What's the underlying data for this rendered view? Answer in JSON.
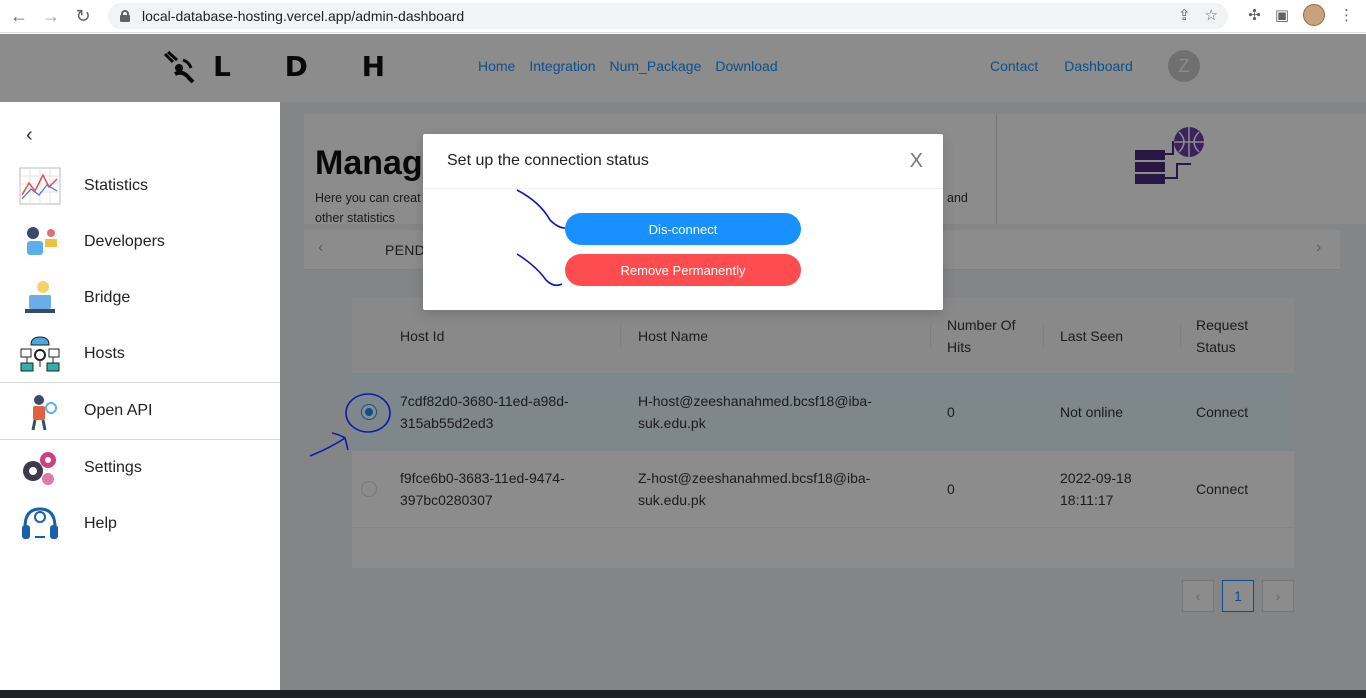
{
  "browser": {
    "url": "local-database-hosting.vercel.app/admin-dashboard"
  },
  "nav": {
    "logo_text": "L D H",
    "links": [
      "Home",
      "Integration",
      "Num_Package",
      "Download"
    ],
    "links_right": [
      "Contact",
      "Dashboard"
    ],
    "avatar_initial": "Z"
  },
  "sidebar": {
    "items": [
      {
        "label": "Statistics",
        "icon": "statistics-icon"
      },
      {
        "label": "Developers",
        "icon": "developers-icon"
      },
      {
        "label": "Bridge",
        "icon": "bridge-icon"
      },
      {
        "label": "Hosts",
        "icon": "hosts-icon"
      },
      {
        "label": "Open API",
        "icon": "open-api-icon"
      },
      {
        "label": "Settings",
        "icon": "settings-icon"
      },
      {
        "label": "Help",
        "icon": "help-icon"
      }
    ]
  },
  "hero": {
    "title": "Manage",
    "description_line1_start": "Here you can creat",
    "description_line1_end": "and",
    "description_line2": "other statistics"
  },
  "tabs": {
    "active": "PEND"
  },
  "table": {
    "headers": {
      "host_id": "Host Id",
      "host_name": "Host Name",
      "hits_line1": "Number Of",
      "hits_line2": "Hits",
      "last_seen": "Last Seen",
      "status_line1": "Request",
      "status_line2": "Status"
    },
    "rows": [
      {
        "host_id_1": "7cdf82d0-3680-11ed-a98d-",
        "host_id_2": "315ab55d2ed3",
        "host_name_1": "H-host@zeeshanahmed.bcsf18@iba-",
        "host_name_2": "suk.edu.pk",
        "hits": "0",
        "last_seen_1": "Not online",
        "last_seen_2": "",
        "status": "Connect",
        "selected": true
      },
      {
        "host_id_1": "f9fce6b0-3683-11ed-9474-",
        "host_id_2": "397bc0280307",
        "host_name_1": "Z-host@zeeshanahmed.bcsf18@iba-",
        "host_name_2": "suk.edu.pk",
        "hits": "0",
        "last_seen_1": "2022-09-18",
        "last_seen_2": "18:11:17",
        "status": "Connect",
        "selected": false
      }
    ]
  },
  "pagination": {
    "prev": "‹",
    "current": "1",
    "next": "›"
  },
  "modal": {
    "title": "Set up the connection status",
    "close": "X",
    "disconnect_label": "Dis-connect",
    "remove_label": "Remove Permanently"
  },
  "colors": {
    "primary": "#1890ff",
    "danger": "#ff4d4f",
    "annotation": "#0a1bb5"
  }
}
